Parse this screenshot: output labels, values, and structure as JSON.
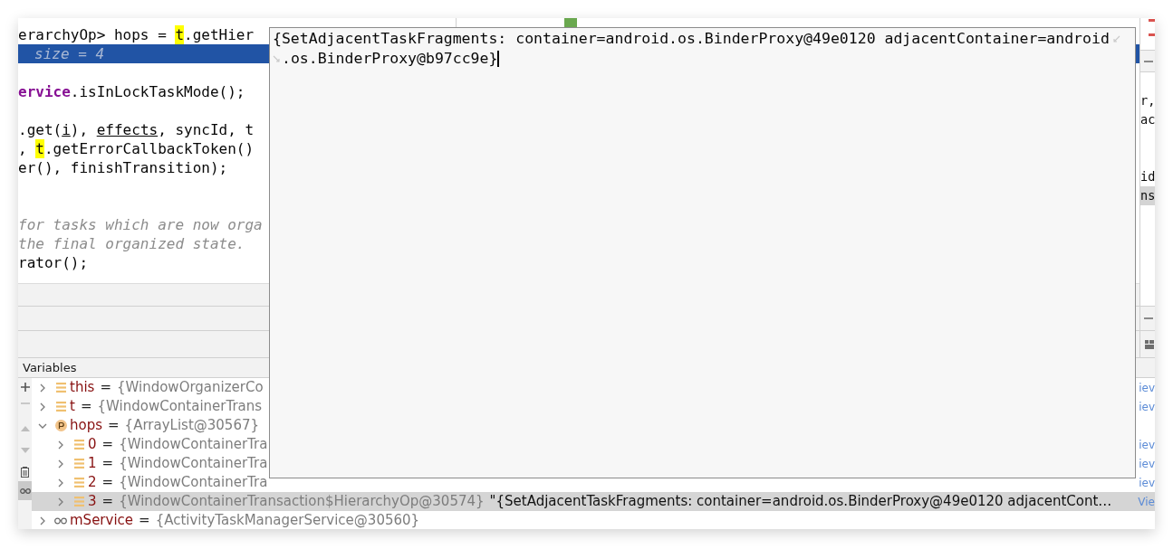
{
  "editor": {
    "lines": [
      {
        "kind": "code",
        "segments": [
          {
            "kind": "plain",
            "text": "erarchyOp> hops = "
          },
          {
            "kind": "match",
            "text": "t"
          },
          {
            "kind": "plain",
            "text": ".getHier"
          }
        ]
      },
      {
        "kind": "code",
        "selected": true,
        "segments": [
          {
            "kind": "inlay",
            "text": "size = 4"
          }
        ]
      },
      {
        "kind": "blank"
      },
      {
        "kind": "code",
        "segments": [
          {
            "kind": "field",
            "text": "ervice"
          },
          {
            "kind": "plain",
            "text": ".isInLockTaskMode();"
          }
        ]
      },
      {
        "kind": "blank"
      },
      {
        "kind": "code",
        "segments": [
          {
            "kind": "plain",
            "text": ".get("
          },
          {
            "kind": "underline",
            "text": "i"
          },
          {
            "kind": "plain",
            "text": "), "
          },
          {
            "kind": "underline",
            "text": "effects"
          },
          {
            "kind": "plain",
            "text": ", syncId, t"
          }
        ]
      },
      {
        "kind": "code",
        "segments": [
          {
            "kind": "plain",
            "text": ", "
          },
          {
            "kind": "match",
            "text": "t"
          },
          {
            "kind": "plain",
            "text": ".getErrorCallbackToken()"
          }
        ]
      },
      {
        "kind": "code",
        "segments": [
          {
            "kind": "plain",
            "text": "er(), finishTransition);"
          }
        ]
      },
      {
        "kind": "blank"
      },
      {
        "kind": "blank"
      },
      {
        "kind": "code",
        "segments": [
          {
            "kind": "comment",
            "text": "for tasks which are now orga"
          }
        ]
      },
      {
        "kind": "code",
        "segments": [
          {
            "kind": "comment",
            "text": "the final organized state."
          }
        ]
      },
      {
        "kind": "code",
        "segments": [
          {
            "kind": "plain",
            "text": "rator();"
          }
        ]
      }
    ]
  },
  "side_editor": {
    "lines": [
      {
        "kind": "blank"
      },
      {
        "kind": "code",
        "text": "r,",
        "selected": false
      },
      {
        "kind": "code",
        "text": "ac",
        "selected": false
      },
      {
        "kind": "blank"
      },
      {
        "kind": "blank"
      },
      {
        "kind": "code",
        "text": "id",
        "selected": false
      },
      {
        "kind": "code",
        "text": "ns",
        "selected": true
      }
    ]
  },
  "variables": {
    "title": "Variables",
    "rows": [
      {
        "kind": "field",
        "name": "this",
        "equals": "=",
        "value": "{WindowOrganizerCo",
        "link": "iev",
        "expanded": false,
        "selected": false
      },
      {
        "kind": "field",
        "name": "t",
        "equals": "=",
        "value": "{WindowContainerTrans",
        "link": "iev",
        "expanded": false,
        "selected": false
      },
      {
        "kind": "param",
        "name": "hops",
        "equals": "=",
        "value": "{ArrayList@30567}",
        "expanded": true,
        "selected": false,
        "children": [
          {
            "kind": "field",
            "name": "0",
            "equals": "=",
            "value": "{WindowContainerTra",
            "link": "iev",
            "expanded": false,
            "selected": false
          },
          {
            "kind": "field",
            "name": "1",
            "equals": "=",
            "value": "{WindowContainerTra",
            "link": "iev",
            "expanded": false,
            "selected": false
          },
          {
            "kind": "field",
            "name": "2",
            "equals": "=",
            "value": "{WindowContainerTra",
            "link": "iev",
            "expanded": false,
            "selected": false
          },
          {
            "kind": "field",
            "name": "3",
            "equals": "=",
            "value": "{WindowContainerTransaction$HierarchyOp@30574}",
            "string": "\"{SetAdjacentTaskFragments: container=android.os.BinderProxy@49e0120 adjacentCont…",
            "link": "Vie",
            "expanded": false,
            "selected": true
          }
        ]
      },
      {
        "kind": "watch",
        "name": "mService",
        "equals": "=",
        "value": "{ActivityTaskManagerService@30560}",
        "expanded": false,
        "selected": false
      }
    ]
  },
  "popup": {
    "lines": [
      "{SetAdjacentTaskFragments: container=android.os.BinderProxy@49e0120 adjacentContainer=android",
      ".os.BinderProxy@b97cc9e}"
    ]
  }
}
